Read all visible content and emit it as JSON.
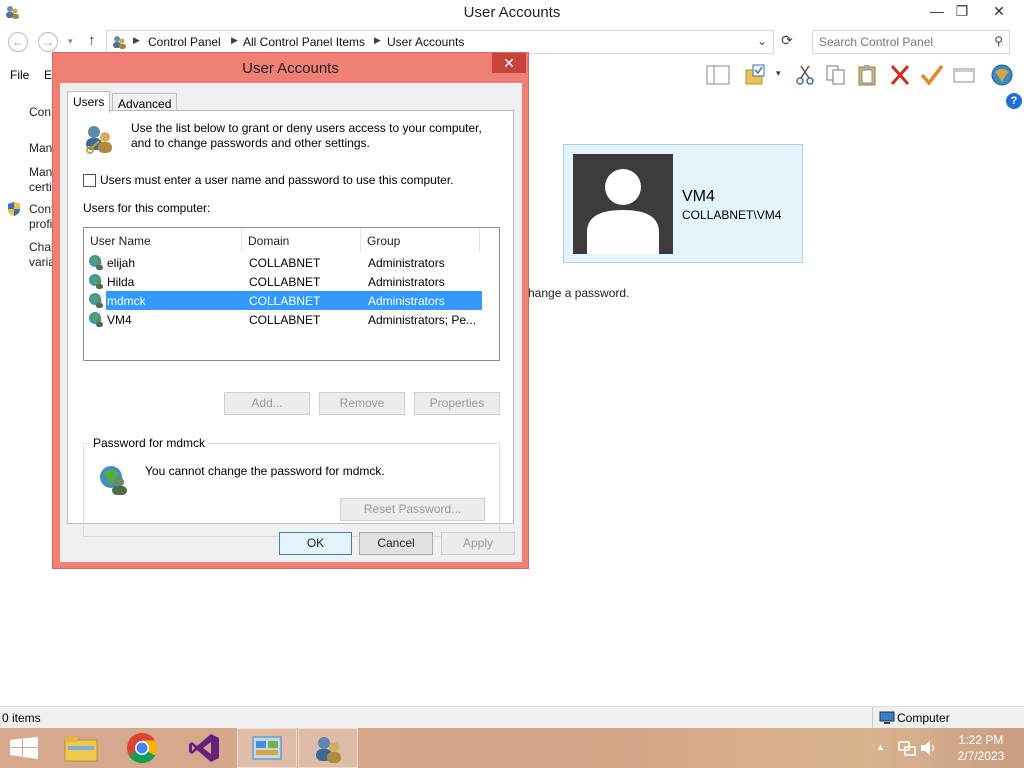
{
  "window": {
    "title": "User Accounts",
    "controls": {
      "minimize": "—",
      "restore": "❐",
      "close": "✕"
    }
  },
  "address": {
    "crumbs": [
      "Control Panel",
      "All Control Panel Items",
      "User Accounts"
    ],
    "search_placeholder": "Search Control Panel"
  },
  "menu": {
    "file": "File",
    "edit": "E"
  },
  "background": {
    "left_links": [
      "Con",
      "Man",
      "Man",
      "certi",
      "Cont",
      "profi",
      "Char",
      "varia"
    ],
    "change_password_text": "hange a password.",
    "card": {
      "name": "VM4",
      "domain": "COLLABNET\\VM4"
    }
  },
  "statusbar": {
    "items": "0 items",
    "zone": "Computer"
  },
  "taskbar": {
    "time": "1:22 PM",
    "date": "2/7/2023"
  },
  "dialog": {
    "title": "User Accounts",
    "close": "✕",
    "tabs": [
      "Users",
      "Advanced"
    ],
    "intro": [
      "Use the list below to grant or deny users access to your computer,",
      "and to change passwords and other settings."
    ],
    "must_login_label": "Users must enter a user name and password to use this computer.",
    "users_label": "Users for this computer:",
    "columns": [
      "User Name",
      "Domain",
      "Group"
    ],
    "users": [
      {
        "name": "elijah",
        "domain": "COLLABNET",
        "group": "Administrators"
      },
      {
        "name": "Hilda",
        "domain": "COLLABNET",
        "group": "Administrators"
      },
      {
        "name": "mdmck",
        "domain": "COLLABNET",
        "group": "Administrators"
      },
      {
        "name": "VM4",
        "domain": "COLLABNET",
        "group": "Administrators; Pe..."
      }
    ],
    "buttons": {
      "add": "Add...",
      "remove": "Remove",
      "properties": "Properties"
    },
    "password_group": {
      "legend": "Password for mdmck",
      "message": "You cannot change the password for mdmck.",
      "reset": "Reset Password..."
    },
    "footer": {
      "ok": "OK",
      "cancel": "Cancel",
      "apply": "Apply"
    }
  }
}
